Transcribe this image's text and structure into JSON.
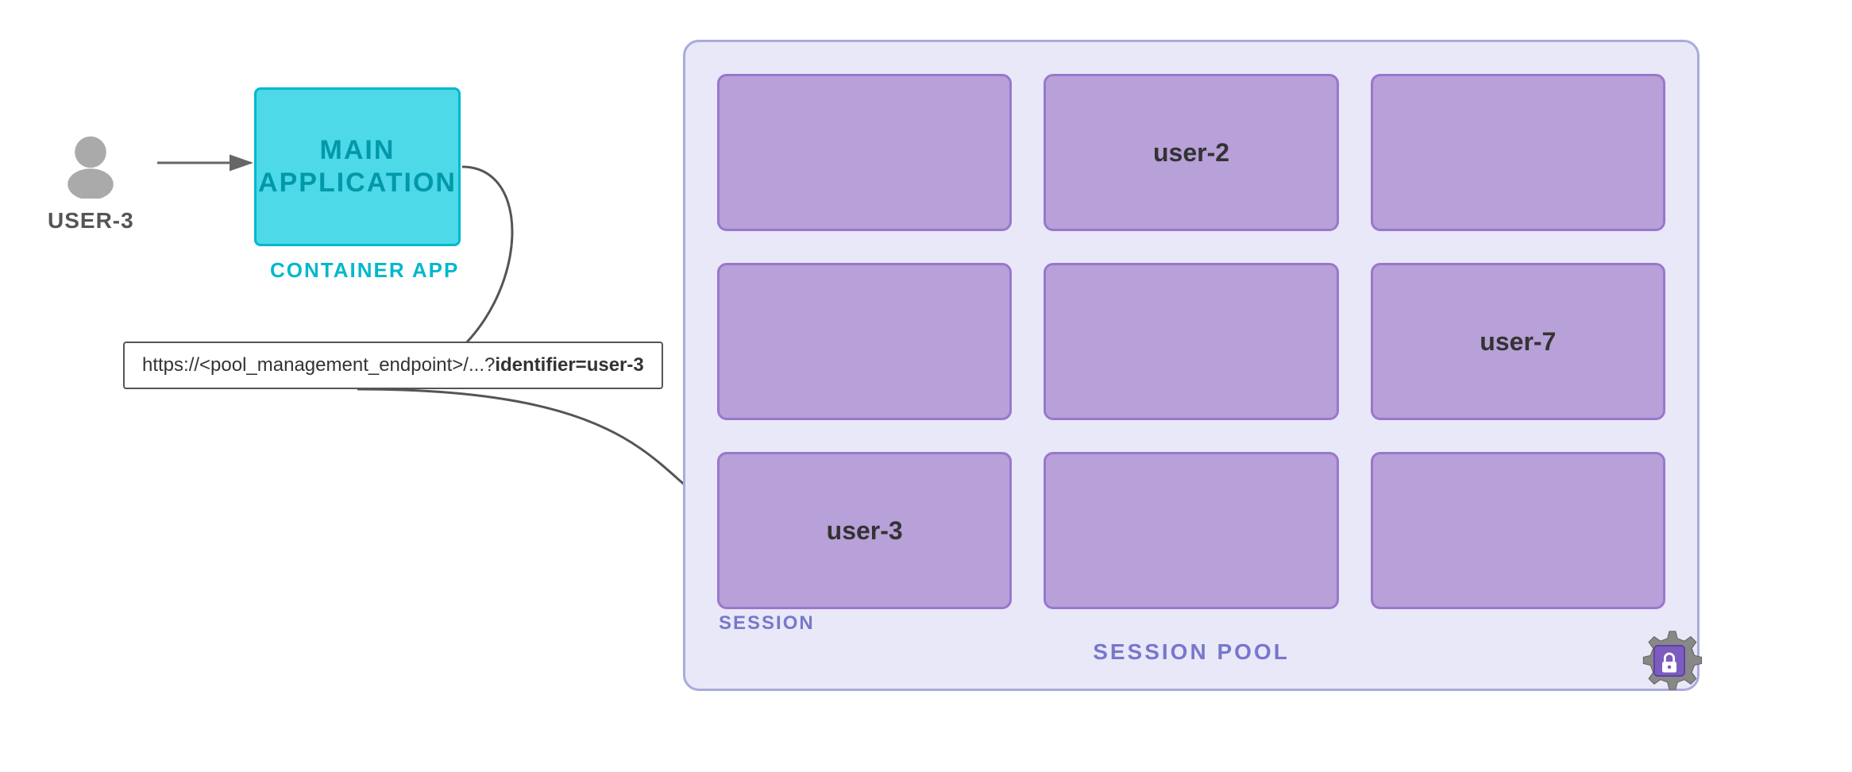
{
  "user": {
    "label": "USER-3",
    "avatar_color": "#999"
  },
  "main_app": {
    "line1": "MAIN",
    "line2": "APPLICATION",
    "container_app_label": "CONTAINER APP"
  },
  "url": {
    "prefix": "https://<pool_management_endpoint>/...?",
    "bold_part": "identifier=user-3"
  },
  "session_pool": {
    "label": "SESSION POOL",
    "session_label": "SESSION",
    "sessions": [
      {
        "id": "s1",
        "text": "",
        "highlighted": false
      },
      {
        "id": "s2",
        "text": "user-2",
        "highlighted": false
      },
      {
        "id": "s3",
        "text": "",
        "highlighted": false
      },
      {
        "id": "s4",
        "text": "",
        "highlighted": false
      },
      {
        "id": "s5",
        "text": "",
        "highlighted": false
      },
      {
        "id": "s6",
        "text": "user-7",
        "highlighted": false
      },
      {
        "id": "s7",
        "text": "user-3",
        "highlighted": true
      },
      {
        "id": "s8",
        "text": "",
        "highlighted": false
      },
      {
        "id": "s9",
        "text": "",
        "highlighted": false
      }
    ]
  }
}
